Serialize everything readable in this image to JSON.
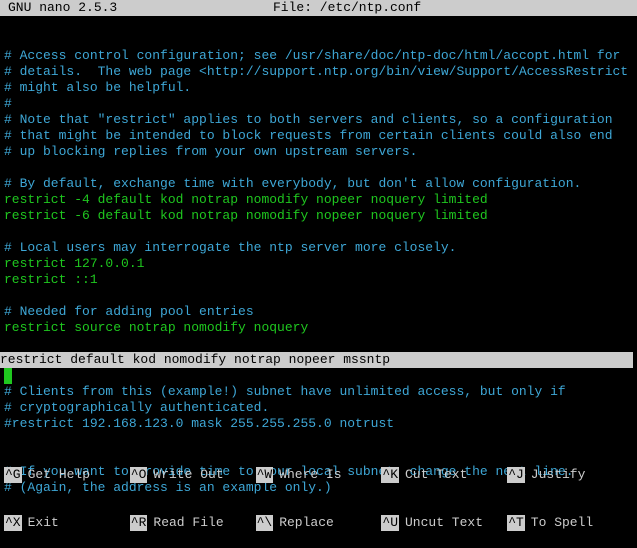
{
  "title": {
    "app": "GNU nano 2.5.3",
    "file_label": "File: /etc/ntp.conf"
  },
  "content": {
    "lines": [
      {
        "kind": "blank",
        "text": ""
      },
      {
        "kind": "blank",
        "text": ""
      },
      {
        "kind": "comment",
        "text": "# Access control configuration; see /usr/share/doc/ntp-doc/html/accopt.html for"
      },
      {
        "kind": "comment",
        "text": "# details.  The web page <http://support.ntp.org/bin/view/Support/AccessRestrict"
      },
      {
        "kind": "comment",
        "text": "# might also be helpful."
      },
      {
        "kind": "comment",
        "text": "#"
      },
      {
        "kind": "comment",
        "text": "# Note that \"restrict\" applies to both servers and clients, so a configuration"
      },
      {
        "kind": "comment",
        "text": "# that might be intended to block requests from certain clients could also end"
      },
      {
        "kind": "comment",
        "text": "# up blocking replies from your own upstream servers."
      },
      {
        "kind": "blank",
        "text": ""
      },
      {
        "kind": "comment",
        "text": "# By default, exchange time with everybody, but don't allow configuration."
      },
      {
        "kind": "green",
        "text": "restrict -4 default kod notrap nomodify nopeer noquery limited"
      },
      {
        "kind": "green",
        "text": "restrict -6 default kod notrap nomodify nopeer noquery limited"
      },
      {
        "kind": "blank",
        "text": ""
      },
      {
        "kind": "comment",
        "text": "# Local users may interrogate the ntp server more closely."
      },
      {
        "kind": "green",
        "text": "restrict 127.0.0.1"
      },
      {
        "kind": "green",
        "text": "restrict ::1"
      },
      {
        "kind": "blank",
        "text": ""
      },
      {
        "kind": "comment",
        "text": "# Needed for adding pool entries"
      },
      {
        "kind": "green",
        "text": "restrict source notrap nomodify noquery"
      },
      {
        "kind": "blank",
        "text": ""
      },
      {
        "kind": "highlight",
        "text": "restrict default kod nomodify notrap nopeer mssntp"
      },
      {
        "kind": "cursor",
        "text": ""
      },
      {
        "kind": "comment",
        "text": "# Clients from this (example!) subnet have unlimited access, but only if"
      },
      {
        "kind": "comment",
        "text": "# cryptographically authenticated."
      },
      {
        "kind": "comment",
        "text": "#restrict 192.168.123.0 mask 255.255.255.0 notrust"
      },
      {
        "kind": "blank",
        "text": ""
      },
      {
        "kind": "blank",
        "text": ""
      },
      {
        "kind": "comment",
        "text": "# If you want to provide time to your local subnet, change the next line."
      },
      {
        "kind": "comment",
        "text": "# (Again, the address is an example only.)"
      }
    ]
  },
  "menu": {
    "row1": [
      {
        "key": "^G",
        "label": "Get Help"
      },
      {
        "key": "^O",
        "label": "Write Out"
      },
      {
        "key": "^W",
        "label": "Where Is"
      },
      {
        "key": "^K",
        "label": "Cut Text"
      },
      {
        "key": "^J",
        "label": "Justify"
      }
    ],
    "row2": [
      {
        "key": "^X",
        "label": "Exit"
      },
      {
        "key": "^R",
        "label": "Read File"
      },
      {
        "key": "^\\",
        "label": "Replace"
      },
      {
        "key": "^U",
        "label": "Uncut Text"
      },
      {
        "key": "^T",
        "label": "To Spell"
      }
    ]
  }
}
